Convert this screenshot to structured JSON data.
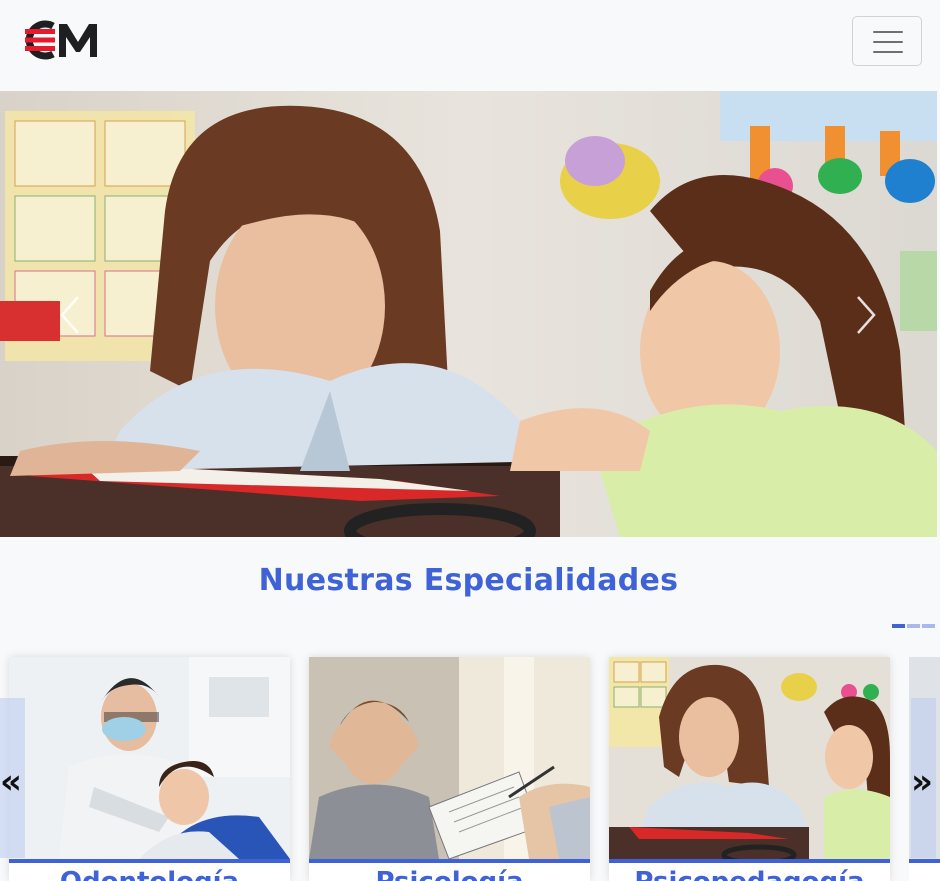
{
  "navbar": {
    "logo_text": "CEM",
    "toggler_icon": "hamburger-icon"
  },
  "hero": {
    "prev_icon": "chevron-left-icon",
    "next_icon": "chevron-right-icon"
  },
  "specialties": {
    "title": "Nuestras Especialidades",
    "cards": [
      {
        "label": "Odontología"
      },
      {
        "label": "Psicología"
      },
      {
        "label": "Psicopedagogía"
      }
    ],
    "prev_label": "«",
    "next_label": "»"
  },
  "colors": {
    "accent": "#3f63d6",
    "logo_red": "#e8192c",
    "logo_dark": "#1f1f22",
    "background": "#f8f9fa"
  }
}
